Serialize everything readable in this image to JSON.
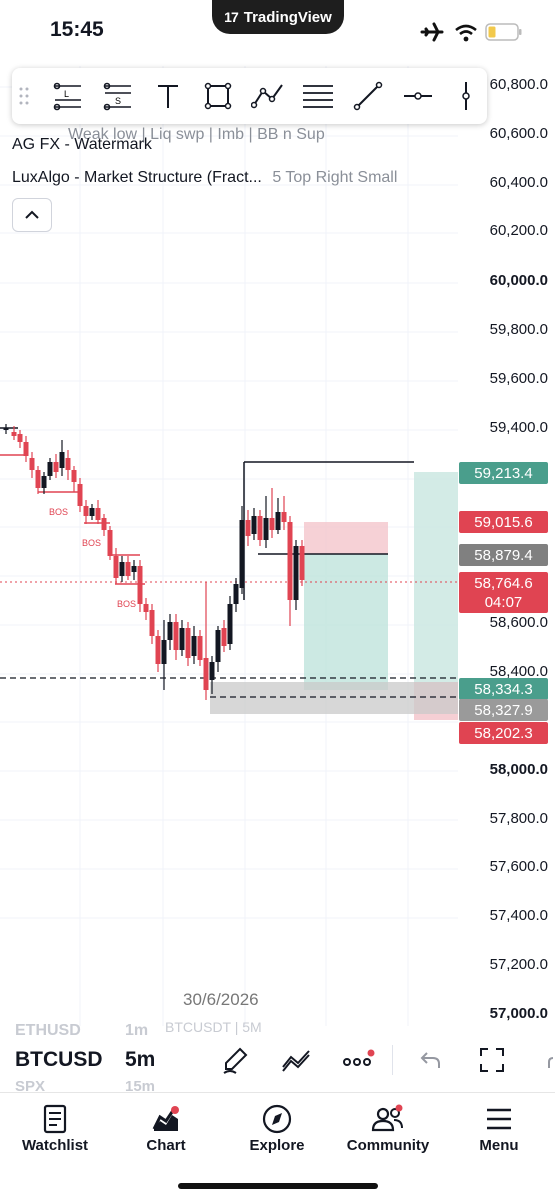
{
  "status_bar": {
    "time": "15:45",
    "app_badge": "TradingView",
    "app_badge_logo": "17"
  },
  "price_axis": {
    "labels": [
      {
        "text": "60,800.0",
        "price": 60800,
        "bold": false
      },
      {
        "text": "60,600.0",
        "price": 60600,
        "bold": false
      },
      {
        "text": "60,400.0",
        "price": 60400,
        "bold": false
      },
      {
        "text": "60,200.0",
        "price": 60200,
        "bold": false
      },
      {
        "text": "60,000.0",
        "price": 60000,
        "bold": true
      },
      {
        "text": "59,800.0",
        "price": 59800,
        "bold": false
      },
      {
        "text": "59,600.0",
        "price": 59600,
        "bold": false
      },
      {
        "text": "59,400.0",
        "price": 59400,
        "bold": false
      },
      {
        "text": "58,600.0",
        "price": 58600,
        "bold": false
      },
      {
        "text": "58,400.0",
        "price": 58400,
        "bold": false
      },
      {
        "text": "58,000.0",
        "price": 58000,
        "bold": true
      },
      {
        "text": "57,800.0",
        "price": 57800,
        "bold": false
      },
      {
        "text": "57,600.0",
        "price": 57600,
        "bold": false
      },
      {
        "text": "57,400.0",
        "price": 57400,
        "bold": false
      },
      {
        "text": "57,200.0",
        "price": 57200,
        "bold": false
      },
      {
        "text": "57,000.0",
        "price": 57000,
        "bold": true
      }
    ],
    "tags": [
      {
        "text": "59,213.4",
        "color": "#4a9e8c"
      },
      {
        "text": "59,015.6",
        "color": "#e04452"
      },
      {
        "text": "58,879.4",
        "color": "#808080"
      },
      {
        "text": "58,764.6",
        "color": "#e04452"
      },
      {
        "text": "04:07",
        "color": "#e04452"
      },
      {
        "text": "58,334.3",
        "color": "#4a9e8c"
      },
      {
        "text": "58,327.9",
        "color": "#9a9a9a"
      },
      {
        "text": "58,202.3",
        "color": "#e04452"
      }
    ]
  },
  "indicators": {
    "row1_overlap": "Weak low  |  Liq swp |  Imb  | BB n Sup",
    "row2": "AG FX - Watermark",
    "row3_name": "LuxAlgo - Market Structure (Fract...",
    "row3_params": "5  Top Right Small"
  },
  "chart_labels": {
    "bos": "BOS",
    "date": "30/6/2026"
  },
  "symbol_bar": {
    "symbol": "BTCUSD",
    "interval": "5m",
    "ghost_symbol_above": "ETHUSD",
    "ghost_interval_above": "1m",
    "ghost_pair_above": "BTCUSDT | 5M",
    "ghost_symbol_below": "SPX",
    "ghost_interval_below": "15m"
  },
  "tabs": [
    {
      "label": "Watchlist",
      "icon": "watchlist-icon"
    },
    {
      "label": "Chart",
      "icon": "chart-icon"
    },
    {
      "label": "Explore",
      "icon": "compass-icon"
    },
    {
      "label": "Community",
      "icon": "community-icon"
    },
    {
      "label": "Menu",
      "icon": "hamburger-icon"
    }
  ],
  "colors": {
    "up": "#131722",
    "down": "#e04452",
    "teal": "#4a9e8c",
    "red": "#e04452",
    "notification": "#e04452"
  }
}
